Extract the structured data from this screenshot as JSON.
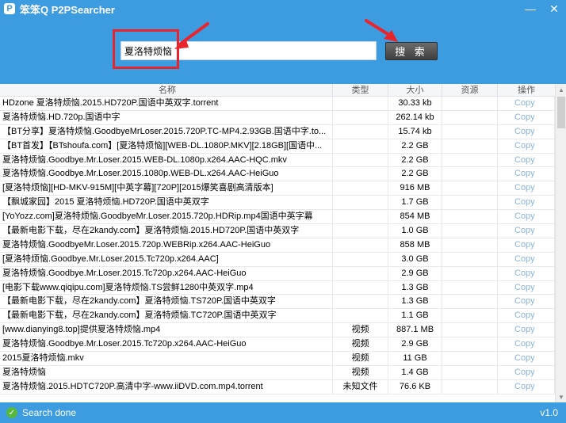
{
  "app": {
    "title": "笨笨Q P2PSearcher",
    "logo_glyph": "P"
  },
  "window_controls": {
    "minimize": "—",
    "close": "✕"
  },
  "search": {
    "query": "夏洛特烦恼",
    "button_label": "搜 索"
  },
  "annotation_color": "#e8252c",
  "table": {
    "headers": {
      "name": "名称",
      "type": "类型",
      "size": "大小",
      "resource": "资源",
      "action": "操作"
    },
    "rows": [
      {
        "name": "HDzone 夏洛特烦恼.2015.HD720P.国语中英双字.torrent",
        "type": "",
        "size": "30.33 kb",
        "resource": "",
        "action": "Copy"
      },
      {
        "name": "夏洛特烦恼.HD.720p.国语中字",
        "type": "",
        "size": "262.14 kb",
        "resource": "",
        "action": "Copy"
      },
      {
        "name": "【BT分享】夏洛特烦恼.GoodbyeMrLoser.2015.720P.TC-MP4.2.93GB.国语中字.to...",
        "type": "",
        "size": "15.74 kb",
        "resource": "",
        "action": "Copy"
      },
      {
        "name": "【BT首发】【BTshoufa.com】[夏洛特烦恼][WEB-DL.1080P.MKV][2.18GB][国语中...",
        "type": "",
        "size": "2.2 GB",
        "resource": "",
        "action": "Copy"
      },
      {
        "name": "夏洛特烦恼.Goodbye.Mr.Loser.2015.WEB-DL.1080p.x264.AAC-HQC.mkv",
        "type": "",
        "size": "2.2 GB",
        "resource": "",
        "action": "Copy"
      },
      {
        "name": "夏洛特烦恼.Goodbye.Mr.Loser.2015.1080p.WEB-DL.x264.AAC-HeiGuo",
        "type": "",
        "size": "2.2 GB",
        "resource": "",
        "action": "Copy"
      },
      {
        "name": "[夏洛特烦恼][HD-MKV-915M][中英字幕][720P][2015爆笑喜剧高清版本]",
        "type": "",
        "size": "916 MB",
        "resource": "",
        "action": "Copy"
      },
      {
        "name": "【飘城家园】2015 夏洛特烦恼.HD720P.国语中英双字",
        "type": "",
        "size": "1.7 GB",
        "resource": "",
        "action": "Copy"
      },
      {
        "name": "[YoYozz.com]夏洛特烦恼.GoodbyeMr.Loser.2015.720p.HDRip.mp4国语中英字幕",
        "type": "",
        "size": "854 MB",
        "resource": "",
        "action": "Copy"
      },
      {
        "name": "【最新电影下载，尽在2kandy.com】夏洛特烦恼.2015.HD720P.国语中英双字",
        "type": "",
        "size": "1.0 GB",
        "resource": "",
        "action": "Copy"
      },
      {
        "name": "夏洛特烦恼.GoodbyeMr.Loser.2015.720p.WEBRip.x264.AAC-HeiGuo",
        "type": "",
        "size": "858 MB",
        "resource": "",
        "action": "Copy"
      },
      {
        "name": "[夏洛特烦恼.Goodbye.Mr.Loser.2015.Tc720p.x264.AAC]",
        "type": "",
        "size": "3.0 GB",
        "resource": "",
        "action": "Copy"
      },
      {
        "name": "夏洛特烦恼.Goodbye.Mr.Loser.2015.Tc720p.x264.AAC-HeiGuo",
        "type": "",
        "size": "2.9 GB",
        "resource": "",
        "action": "Copy"
      },
      {
        "name": "[电影下载www.qiqipu.com]夏洛特烦恼.TS尝鲜1280中英双字.mp4",
        "type": "",
        "size": "1.3 GB",
        "resource": "",
        "action": "Copy"
      },
      {
        "name": "【最新电影下载，尽在2kandy.com】夏洛特烦恼.TS720P.国语中英双字",
        "type": "",
        "size": "1.3 GB",
        "resource": "",
        "action": "Copy"
      },
      {
        "name": "【最新电影下载，尽在2kandy.com】夏洛特烦恼.TC720P.国语中英双字",
        "type": "",
        "size": "1.1 GB",
        "resource": "",
        "action": "Copy"
      },
      {
        "name": "[www.dianying8.top]提供夏洛特烦恼.mp4",
        "type": "视频",
        "size": "887.1 MB",
        "resource": "",
        "action": "Copy"
      },
      {
        "name": "夏洛特烦恼.Goodbye.Mr.Loser.2015.Tc720p.x264.AAC-HeiGuo",
        "type": "视频",
        "size": "2.9 GB",
        "resource": "",
        "action": "Copy"
      },
      {
        "name": "2015夏洛特烦恼.mkv",
        "type": "视频",
        "size": "11 GB",
        "resource": "",
        "action": "Copy"
      },
      {
        "name": "夏洛特烦恼",
        "type": "视频",
        "size": "1.4 GB",
        "resource": "",
        "action": "Copy"
      },
      {
        "name": "夏洛特烦恼.2015.HDTC720P.高清中字-www.iiDVD.com.mp4.torrent",
        "type": "未知文件",
        "size": "76.6 KB",
        "resource": "",
        "action": "Copy"
      }
    ]
  },
  "status": {
    "text": "Search done",
    "icon": "check-icon",
    "version": "v1.0"
  }
}
